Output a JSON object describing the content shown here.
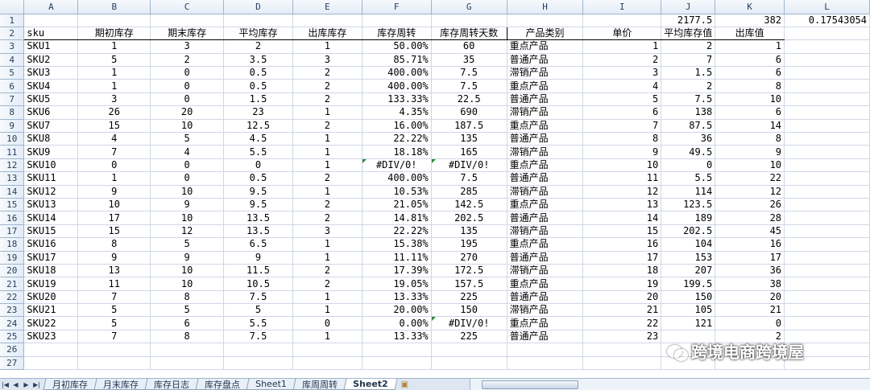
{
  "columns": [
    "A",
    "B",
    "C",
    "D",
    "E",
    "F",
    "G",
    "H",
    "I",
    "J",
    "K",
    "L"
  ],
  "row1": {
    "J": "2177.5",
    "K": "382",
    "L": "0.17543054"
  },
  "header": {
    "A": "sku",
    "B": "期初库存",
    "C": "期末库存",
    "D": "平均库存",
    "E": "出库库存",
    "F": "库存周转",
    "G": "库存周转天数",
    "H": "产品类别",
    "I": "单价",
    "J": "平均库存值",
    "K": "出库值"
  },
  "rows": [
    [
      "SKU1",
      "1",
      "3",
      "2",
      "1",
      "50.00%",
      "60",
      "重点产品",
      "1",
      "2",
      "1"
    ],
    [
      "SKU2",
      "5",
      "2",
      "3.5",
      "3",
      "85.71%",
      "35",
      "普通产品",
      "2",
      "7",
      "6"
    ],
    [
      "SKU3",
      "1",
      "0",
      "0.5",
      "2",
      "400.00%",
      "7.5",
      "滞销产品",
      "3",
      "1.5",
      "6"
    ],
    [
      "SKU4",
      "1",
      "0",
      "0.5",
      "2",
      "400.00%",
      "7.5",
      "重点产品",
      "4",
      "2",
      "8"
    ],
    [
      "SKU5",
      "3",
      "0",
      "1.5",
      "2",
      "133.33%",
      "22.5",
      "普通产品",
      "5",
      "7.5",
      "10"
    ],
    [
      "SKU6",
      "26",
      "20",
      "23",
      "1",
      "4.35%",
      "690",
      "滞销产品",
      "6",
      "138",
      "6"
    ],
    [
      "SKU7",
      "15",
      "10",
      "12.5",
      "2",
      "16.00%",
      "187.5",
      "重点产品",
      "7",
      "87.5",
      "14"
    ],
    [
      "SKU8",
      "4",
      "5",
      "4.5",
      "1",
      "22.22%",
      "135",
      "普通产品",
      "8",
      "36",
      "8"
    ],
    [
      "SKU9",
      "7",
      "4",
      "5.5",
      "1",
      "18.18%",
      "165",
      "滞销产品",
      "9",
      "49.5",
      "9"
    ],
    [
      "SKU10",
      "0",
      "0",
      "0",
      "1",
      "#DIV/0!",
      "#DIV/0!",
      "重点产品",
      "10",
      "0",
      "10"
    ],
    [
      "SKU11",
      "1",
      "0",
      "0.5",
      "2",
      "400.00%",
      "7.5",
      "普通产品",
      "11",
      "5.5",
      "22"
    ],
    [
      "SKU12",
      "9",
      "10",
      "9.5",
      "1",
      "10.53%",
      "285",
      "滞销产品",
      "12",
      "114",
      "12"
    ],
    [
      "SKU13",
      "10",
      "9",
      "9.5",
      "2",
      "21.05%",
      "142.5",
      "重点产品",
      "13",
      "123.5",
      "26"
    ],
    [
      "SKU14",
      "17",
      "10",
      "13.5",
      "2",
      "14.81%",
      "202.5",
      "普通产品",
      "14",
      "189",
      "28"
    ],
    [
      "SKU15",
      "15",
      "12",
      "13.5",
      "3",
      "22.22%",
      "135",
      "滞销产品",
      "15",
      "202.5",
      "45"
    ],
    [
      "SKU16",
      "8",
      "5",
      "6.5",
      "1",
      "15.38%",
      "195",
      "重点产品",
      "16",
      "104",
      "16"
    ],
    [
      "SKU17",
      "9",
      "9",
      "9",
      "1",
      "11.11%",
      "270",
      "普通产品",
      "17",
      "153",
      "17"
    ],
    [
      "SKU18",
      "13",
      "10",
      "11.5",
      "2",
      "17.39%",
      "172.5",
      "滞销产品",
      "18",
      "207",
      "36"
    ],
    [
      "SKU19",
      "11",
      "10",
      "10.5",
      "2",
      "19.05%",
      "157.5",
      "重点产品",
      "19",
      "199.5",
      "38"
    ],
    [
      "SKU20",
      "7",
      "8",
      "7.5",
      "1",
      "13.33%",
      "225",
      "普通产品",
      "20",
      "150",
      "20"
    ],
    [
      "SKU21",
      "5",
      "5",
      "5",
      "1",
      "20.00%",
      "150",
      "滞销产品",
      "21",
      "105",
      "21"
    ],
    [
      "SKU22",
      "5",
      "6",
      "5.5",
      "0",
      "0.00%",
      "#DIV/0!",
      "重点产品",
      "22",
      "121",
      "0"
    ],
    [
      "SKU23",
      "7",
      "8",
      "7.5",
      "1",
      "13.33%",
      "225",
      "普通产品",
      "23",
      "",
      "2"
    ]
  ],
  "sheet_tabs": [
    "月初库存",
    "月末库存",
    "库存日志",
    "库存盘点",
    "Sheet1",
    "库周周转",
    "Sheet2"
  ],
  "active_tab": "Sheet2",
  "watermark": "跨境电商跨境屋",
  "icons": {
    "first": "nav-first-icon",
    "prev": "nav-prev-icon",
    "next": "nav-next-icon",
    "last": "nav-last-icon",
    "new_sheet": "insert-sheet-icon",
    "watermark": "wechat-logo-icon"
  }
}
